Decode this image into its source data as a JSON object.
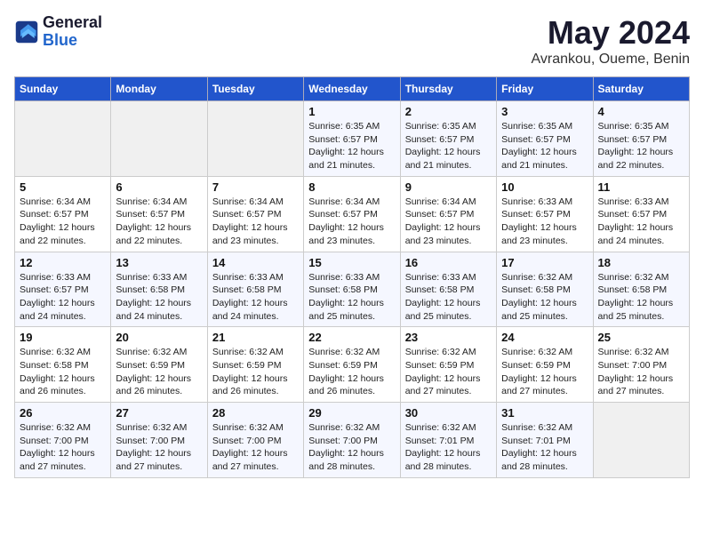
{
  "header": {
    "logo_line1": "General",
    "logo_line2": "Blue",
    "month_title": "May 2024",
    "location": "Avrankou, Oueme, Benin"
  },
  "weekdays": [
    "Sunday",
    "Monday",
    "Tuesday",
    "Wednesday",
    "Thursday",
    "Friday",
    "Saturday"
  ],
  "weeks": [
    [
      {
        "day": "",
        "info": ""
      },
      {
        "day": "",
        "info": ""
      },
      {
        "day": "",
        "info": ""
      },
      {
        "day": "1",
        "info": "Sunrise: 6:35 AM\nSunset: 6:57 PM\nDaylight: 12 hours\nand 21 minutes."
      },
      {
        "day": "2",
        "info": "Sunrise: 6:35 AM\nSunset: 6:57 PM\nDaylight: 12 hours\nand 21 minutes."
      },
      {
        "day": "3",
        "info": "Sunrise: 6:35 AM\nSunset: 6:57 PM\nDaylight: 12 hours\nand 21 minutes."
      },
      {
        "day": "4",
        "info": "Sunrise: 6:35 AM\nSunset: 6:57 PM\nDaylight: 12 hours\nand 22 minutes."
      }
    ],
    [
      {
        "day": "5",
        "info": "Sunrise: 6:34 AM\nSunset: 6:57 PM\nDaylight: 12 hours\nand 22 minutes."
      },
      {
        "day": "6",
        "info": "Sunrise: 6:34 AM\nSunset: 6:57 PM\nDaylight: 12 hours\nand 22 minutes."
      },
      {
        "day": "7",
        "info": "Sunrise: 6:34 AM\nSunset: 6:57 PM\nDaylight: 12 hours\nand 23 minutes."
      },
      {
        "day": "8",
        "info": "Sunrise: 6:34 AM\nSunset: 6:57 PM\nDaylight: 12 hours\nand 23 minutes."
      },
      {
        "day": "9",
        "info": "Sunrise: 6:34 AM\nSunset: 6:57 PM\nDaylight: 12 hours\nand 23 minutes."
      },
      {
        "day": "10",
        "info": "Sunrise: 6:33 AM\nSunset: 6:57 PM\nDaylight: 12 hours\nand 23 minutes."
      },
      {
        "day": "11",
        "info": "Sunrise: 6:33 AM\nSunset: 6:57 PM\nDaylight: 12 hours\nand 24 minutes."
      }
    ],
    [
      {
        "day": "12",
        "info": "Sunrise: 6:33 AM\nSunset: 6:57 PM\nDaylight: 12 hours\nand 24 minutes."
      },
      {
        "day": "13",
        "info": "Sunrise: 6:33 AM\nSunset: 6:58 PM\nDaylight: 12 hours\nand 24 minutes."
      },
      {
        "day": "14",
        "info": "Sunrise: 6:33 AM\nSunset: 6:58 PM\nDaylight: 12 hours\nand 24 minutes."
      },
      {
        "day": "15",
        "info": "Sunrise: 6:33 AM\nSunset: 6:58 PM\nDaylight: 12 hours\nand 25 minutes."
      },
      {
        "day": "16",
        "info": "Sunrise: 6:33 AM\nSunset: 6:58 PM\nDaylight: 12 hours\nand 25 minutes."
      },
      {
        "day": "17",
        "info": "Sunrise: 6:32 AM\nSunset: 6:58 PM\nDaylight: 12 hours\nand 25 minutes."
      },
      {
        "day": "18",
        "info": "Sunrise: 6:32 AM\nSunset: 6:58 PM\nDaylight: 12 hours\nand 25 minutes."
      }
    ],
    [
      {
        "day": "19",
        "info": "Sunrise: 6:32 AM\nSunset: 6:58 PM\nDaylight: 12 hours\nand 26 minutes."
      },
      {
        "day": "20",
        "info": "Sunrise: 6:32 AM\nSunset: 6:59 PM\nDaylight: 12 hours\nand 26 minutes."
      },
      {
        "day": "21",
        "info": "Sunrise: 6:32 AM\nSunset: 6:59 PM\nDaylight: 12 hours\nand 26 minutes."
      },
      {
        "day": "22",
        "info": "Sunrise: 6:32 AM\nSunset: 6:59 PM\nDaylight: 12 hours\nand 26 minutes."
      },
      {
        "day": "23",
        "info": "Sunrise: 6:32 AM\nSunset: 6:59 PM\nDaylight: 12 hours\nand 27 minutes."
      },
      {
        "day": "24",
        "info": "Sunrise: 6:32 AM\nSunset: 6:59 PM\nDaylight: 12 hours\nand 27 minutes."
      },
      {
        "day": "25",
        "info": "Sunrise: 6:32 AM\nSunset: 7:00 PM\nDaylight: 12 hours\nand 27 minutes."
      }
    ],
    [
      {
        "day": "26",
        "info": "Sunrise: 6:32 AM\nSunset: 7:00 PM\nDaylight: 12 hours\nand 27 minutes."
      },
      {
        "day": "27",
        "info": "Sunrise: 6:32 AM\nSunset: 7:00 PM\nDaylight: 12 hours\nand 27 minutes."
      },
      {
        "day": "28",
        "info": "Sunrise: 6:32 AM\nSunset: 7:00 PM\nDaylight: 12 hours\nand 27 minutes."
      },
      {
        "day": "29",
        "info": "Sunrise: 6:32 AM\nSunset: 7:00 PM\nDaylight: 12 hours\nand 28 minutes."
      },
      {
        "day": "30",
        "info": "Sunrise: 6:32 AM\nSunset: 7:01 PM\nDaylight: 12 hours\nand 28 minutes."
      },
      {
        "day": "31",
        "info": "Sunrise: 6:32 AM\nSunset: 7:01 PM\nDaylight: 12 hours\nand 28 minutes."
      },
      {
        "day": "",
        "info": ""
      }
    ]
  ]
}
